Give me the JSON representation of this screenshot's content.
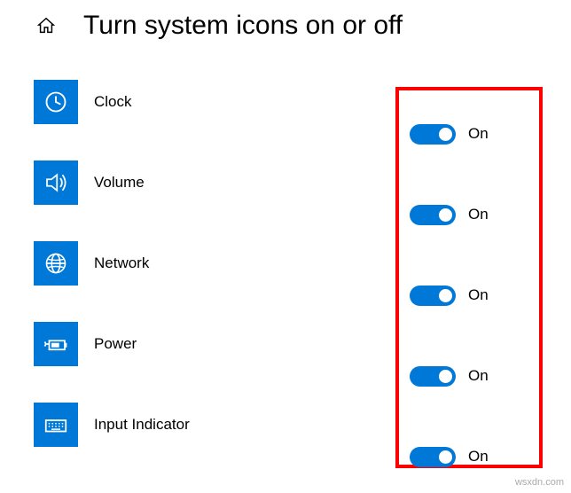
{
  "header": {
    "title": "Turn system icons on or off"
  },
  "items": [
    {
      "icon": "clock-icon",
      "label": "Clock",
      "state": "On"
    },
    {
      "icon": "volume-icon",
      "label": "Volume",
      "state": "On"
    },
    {
      "icon": "network-icon",
      "label": "Network",
      "state": "On"
    },
    {
      "icon": "power-icon",
      "label": "Power",
      "state": "On"
    },
    {
      "icon": "keyboard-icon",
      "label": "Input Indicator",
      "state": "On"
    }
  ],
  "watermark": "wsxdn.com"
}
